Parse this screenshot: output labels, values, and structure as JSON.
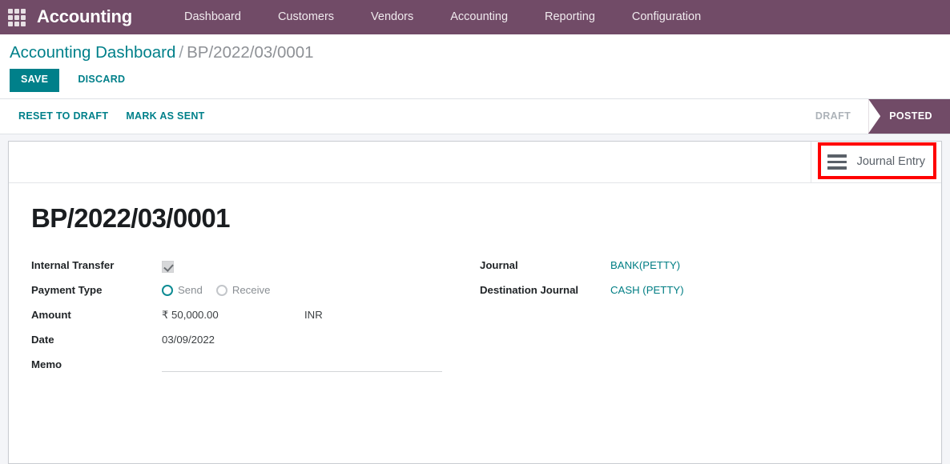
{
  "navbar": {
    "apps_icon": "apps-grid-icon",
    "brand": "Accounting",
    "menu_items": [
      {
        "label": "Dashboard"
      },
      {
        "label": "Customers"
      },
      {
        "label": "Vendors"
      },
      {
        "label": "Accounting"
      },
      {
        "label": "Reporting"
      },
      {
        "label": "Configuration"
      }
    ]
  },
  "control_panel": {
    "breadcrumb": {
      "parent": "Accounting Dashboard",
      "separator": "/",
      "current": "BP/2022/03/0001"
    },
    "save_label": "SAVE",
    "discard_label": "DISCARD"
  },
  "statusbar": {
    "actions": [
      {
        "label": "RESET TO DRAFT"
      },
      {
        "label": "MARK AS SENT"
      }
    ],
    "stages": [
      {
        "label": "DRAFT",
        "active": false
      },
      {
        "label": "POSTED",
        "active": true
      }
    ]
  },
  "sheet": {
    "smart_button": {
      "icon": "list-lines-icon",
      "label": "Journal Entry",
      "highlight_color": "#ff0000"
    },
    "record_title": "BP/2022/03/0001",
    "left_fields": {
      "internal_transfer": {
        "label": "Internal Transfer",
        "checked": true
      },
      "payment_type": {
        "label": "Payment Type",
        "options": [
          {
            "label": "Send",
            "selected": true
          },
          {
            "label": "Receive",
            "selected": false
          }
        ]
      },
      "amount": {
        "label": "Amount",
        "value": "₹ 50,000.00",
        "currency": "INR"
      },
      "date": {
        "label": "Date",
        "value": "03/09/2022"
      },
      "memo": {
        "label": "Memo",
        "value": ""
      }
    },
    "right_fields": {
      "journal": {
        "label": "Journal",
        "value": "BANK(PETTY)"
      },
      "destination_journal": {
        "label": "Destination Journal",
        "value": "CASH (PETTY)"
      }
    }
  },
  "colors": {
    "brand_purple": "#714B67",
    "accent_teal": "#00808a",
    "link_teal": "#017e84",
    "page_bg": "#f4f5f8",
    "highlight_red": "#ff0000"
  }
}
